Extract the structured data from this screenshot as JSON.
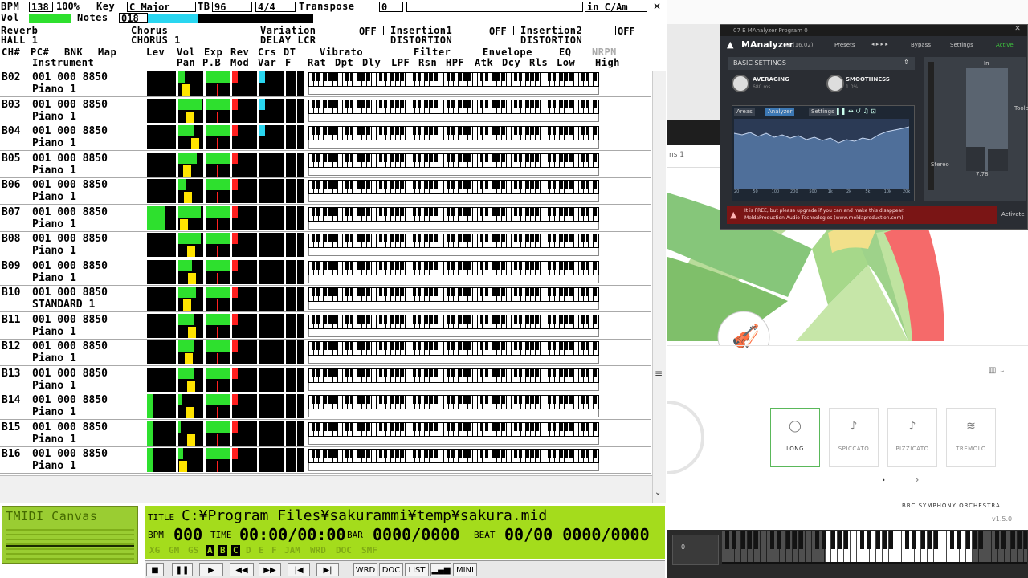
{
  "header": {
    "bpm_label": "BPM",
    "bpm": "138",
    "percent": "100%",
    "key_label": "Key",
    "key": "C Major",
    "tb_label": "TB",
    "tb": "96",
    "time_sig": "4/4",
    "transpose_label": "Transpose",
    "transpose": "0",
    "in_key": "in C/Am",
    "vol_label": "Vol",
    "notes_label": "Notes",
    "notes": "018"
  },
  "effects": {
    "reverb_label": "Reverb",
    "reverb": "HALL 1",
    "chorus_label": "Chorus",
    "chorus": "CHORUS 1",
    "variation_label": "Variation",
    "variation_state": "OFF",
    "variation": "DELAY LCR",
    "insertion1_label": "Insertion1",
    "insertion1_state": "OFF",
    "insertion1": "DISTORTION",
    "insertion2_label": "Insertion2",
    "insertion2_state": "OFF",
    "insertion2": "DISTORTION"
  },
  "columns": {
    "line1": "CH# PC# BNK Map    Lev Vol Exp Rev CrsDT   Vibrato  LPF Filter   Envelope  EQ   NRPN",
    "line2": "  Instrument           PanP.B Mod Var F     Rat Dpt Dly LPF Rsn HPF Atk Dcy Rls Low  High",
    "ch": "CH#",
    "pc": "PC#",
    "bnk": "BNK",
    "map": "Map",
    "instrument": "Instrument",
    "lev": "Lev",
    "vol": "Vol",
    "exp": "Exp",
    "rev": "Rev",
    "crs": "Crs",
    "dt": "DT",
    "vibrato": "Vibrato",
    "filter": "Filter",
    "envelope": "Envelope",
    "eq": "EQ",
    "nrpn": "NRPN",
    "pan": "Pan",
    "pb": "P.B",
    "mod": "Mod",
    "var": "Var",
    "f": "F",
    "rat": "Rat",
    "dpt": "Dpt",
    "dly": "Dly",
    "lpf": "LPF",
    "rsn": "Rsn",
    "hpf": "HPF",
    "atk": "Atk",
    "dcy": "Dcy",
    "rls": "Rls",
    "low": "Low",
    "high": "High"
  },
  "channels": [
    {
      "ch": "B02",
      "pc": "001 000 8850",
      "instrument": "Piano 1",
      "lev": 0.0,
      "vol": 0.25,
      "pan": 0.2,
      "cho": true
    },
    {
      "ch": "B03",
      "pc": "001 000 8850",
      "instrument": "Piano 1",
      "lev": 0.0,
      "vol": 0.95,
      "pan": 0.45,
      "cho": true
    },
    {
      "ch": "B04",
      "pc": "001 000 8850",
      "instrument": "Piano 1",
      "lev": 0.0,
      "vol": 0.6,
      "pan": 0.75,
      "cho": true
    },
    {
      "ch": "B05",
      "pc": "001 000 8850",
      "instrument": "Piano 1",
      "lev": 0.0,
      "vol": 0.75,
      "pan": 0.3,
      "cho": false
    },
    {
      "ch": "B06",
      "pc": "001 000 8850",
      "instrument": "Piano 1",
      "lev": 0.0,
      "vol": 0.3,
      "pan": 0.35,
      "cho": false
    },
    {
      "ch": "B07",
      "pc": "001 000 8850",
      "instrument": "Piano 1",
      "lev": 0.6,
      "vol": 0.9,
      "pan": 0.1,
      "cho": false
    },
    {
      "ch": "B08",
      "pc": "001 000 8850",
      "instrument": "Piano 1",
      "lev": 0.0,
      "vol": 0.9,
      "pan": 0.5,
      "cho": false
    },
    {
      "ch": "B09",
      "pc": "001 000 8850",
      "instrument": "Piano 1",
      "lev": 0.0,
      "vol": 0.55,
      "pan": 0.55,
      "cho": false
    },
    {
      "ch": "B10",
      "pc": "001 000 8850",
      "instrument": "STANDARD 1",
      "lev": 0.0,
      "vol": 0.7,
      "pan": 0.3,
      "cho": false
    },
    {
      "ch": "B11",
      "pc": "001 000 8850",
      "instrument": "Piano 1",
      "lev": 0.0,
      "vol": 0.65,
      "pan": 0.55,
      "cho": false
    },
    {
      "ch": "B12",
      "pc": "001 000 8850",
      "instrument": "Piano 1",
      "lev": 0.0,
      "vol": 0.6,
      "pan": 0.4,
      "cho": false
    },
    {
      "ch": "B13",
      "pc": "001 000 8850",
      "instrument": "Piano 1",
      "lev": 0.0,
      "vol": 0.65,
      "pan": 0.5,
      "cho": false
    },
    {
      "ch": "B14",
      "pc": "001 000 8850",
      "instrument": "Piano 1",
      "lev": 0.2,
      "vol": 0.15,
      "pan": 0.45,
      "cho": false
    },
    {
      "ch": "B15",
      "pc": "001 000 8850",
      "instrument": "Piano 1",
      "lev": 0.2,
      "vol": 0.1,
      "pan": 0.5,
      "cho": false
    },
    {
      "ch": "B16",
      "pc": "001 000 8850",
      "instrument": "Piano 1",
      "lev": 0.2,
      "vol": 0.2,
      "pan": 0.05,
      "cho": false
    }
  ],
  "canvas": {
    "logo": "TMIDI Canvas"
  },
  "info": {
    "title_label": "TITLE",
    "title": "C:¥Program Files¥sakurammi¥temp¥sakura.mid",
    "bpm_label": "BPM",
    "bpm": "000",
    "time_label": "TIME",
    "time": "00:00/00:00",
    "bar_label": "BAR",
    "bar": "0000/0000",
    "beat_label": "BEAT",
    "beat": "00/00 0000/0000",
    "indicators": [
      "XG",
      "GM",
      "GS",
      "A",
      "B",
      "C",
      "D",
      "E",
      "F",
      "JAM",
      "WRD",
      "DOC",
      "SMF"
    ]
  },
  "toolbar": {
    "wrd": "WRD",
    "doc": "DOC",
    "list": "LIST",
    "mini": "MINI"
  },
  "manalyzer": {
    "window_title": "07 E MAnalyzer Program 0",
    "name": "MAnalyzer",
    "version": "(16.02)",
    "presets": "Presets",
    "bypass": "Bypass",
    "settings": "Settings",
    "active": "Active",
    "basic_settings": "BASIC SETTINGS",
    "averaging_label": "AVERAGING",
    "averaging_value": "680 ms",
    "smoothness_label": "SMOOTHNESS",
    "smoothness_value": "1.0%",
    "tabs": [
      "Areas",
      "Analyzer",
      "Settings"
    ],
    "meter_top": "In",
    "meter_value": "7.78",
    "stereo": "Stereo",
    "toolbar": "Toolbar",
    "notice_1": "It is FREE, but please upgrade if you can and make this disappear.",
    "notice_2": "MeldaProduction Audio Technologies (www.meldaproduction.com)",
    "activate": "Activate",
    "freq_labels": [
      "20",
      "50",
      "100",
      "200",
      "500",
      "1k",
      "2k",
      "5k",
      "10k",
      "20k"
    ]
  },
  "bbc": {
    "brand": "BBC SYMPHONY ORCHESTRA",
    "version": "v1.5.0",
    "articulations": [
      "LONG",
      "SPICCATO",
      "PIZZICATO",
      "TREMOLO"
    ],
    "tab_label": "ns 1"
  },
  "colors": {
    "lcd_green": "#a4dc1c",
    "meter_green": "#2ee02e",
    "pan_yellow": "#ffe400",
    "rev_red": "#ff2020",
    "cho_cyan": "#29d6f0"
  }
}
